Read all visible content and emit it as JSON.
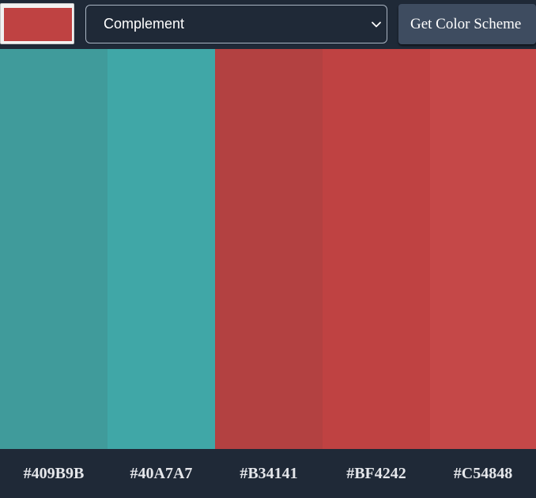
{
  "seed_color": {
    "value": "#BF4242",
    "icon": "color-swatch"
  },
  "scheme_mode": {
    "selected": "Complement",
    "icon": "chevron-down-icon"
  },
  "get_button": {
    "label": "Get Color Scheme"
  },
  "colors": [
    {
      "hex": "#409B9B",
      "label": "#409B9B"
    },
    {
      "hex": "#40A7A7",
      "label": "#40A7A7"
    },
    {
      "hex": "#B34141",
      "label": "#B34141"
    },
    {
      "hex": "#BF4242",
      "label": "#BF4242"
    },
    {
      "hex": "#C54848",
      "label": "#C54848"
    }
  ],
  "theme": {
    "background": "#1F2937",
    "button_background": "#3E4C60",
    "label_text": "#E5E7EB"
  }
}
